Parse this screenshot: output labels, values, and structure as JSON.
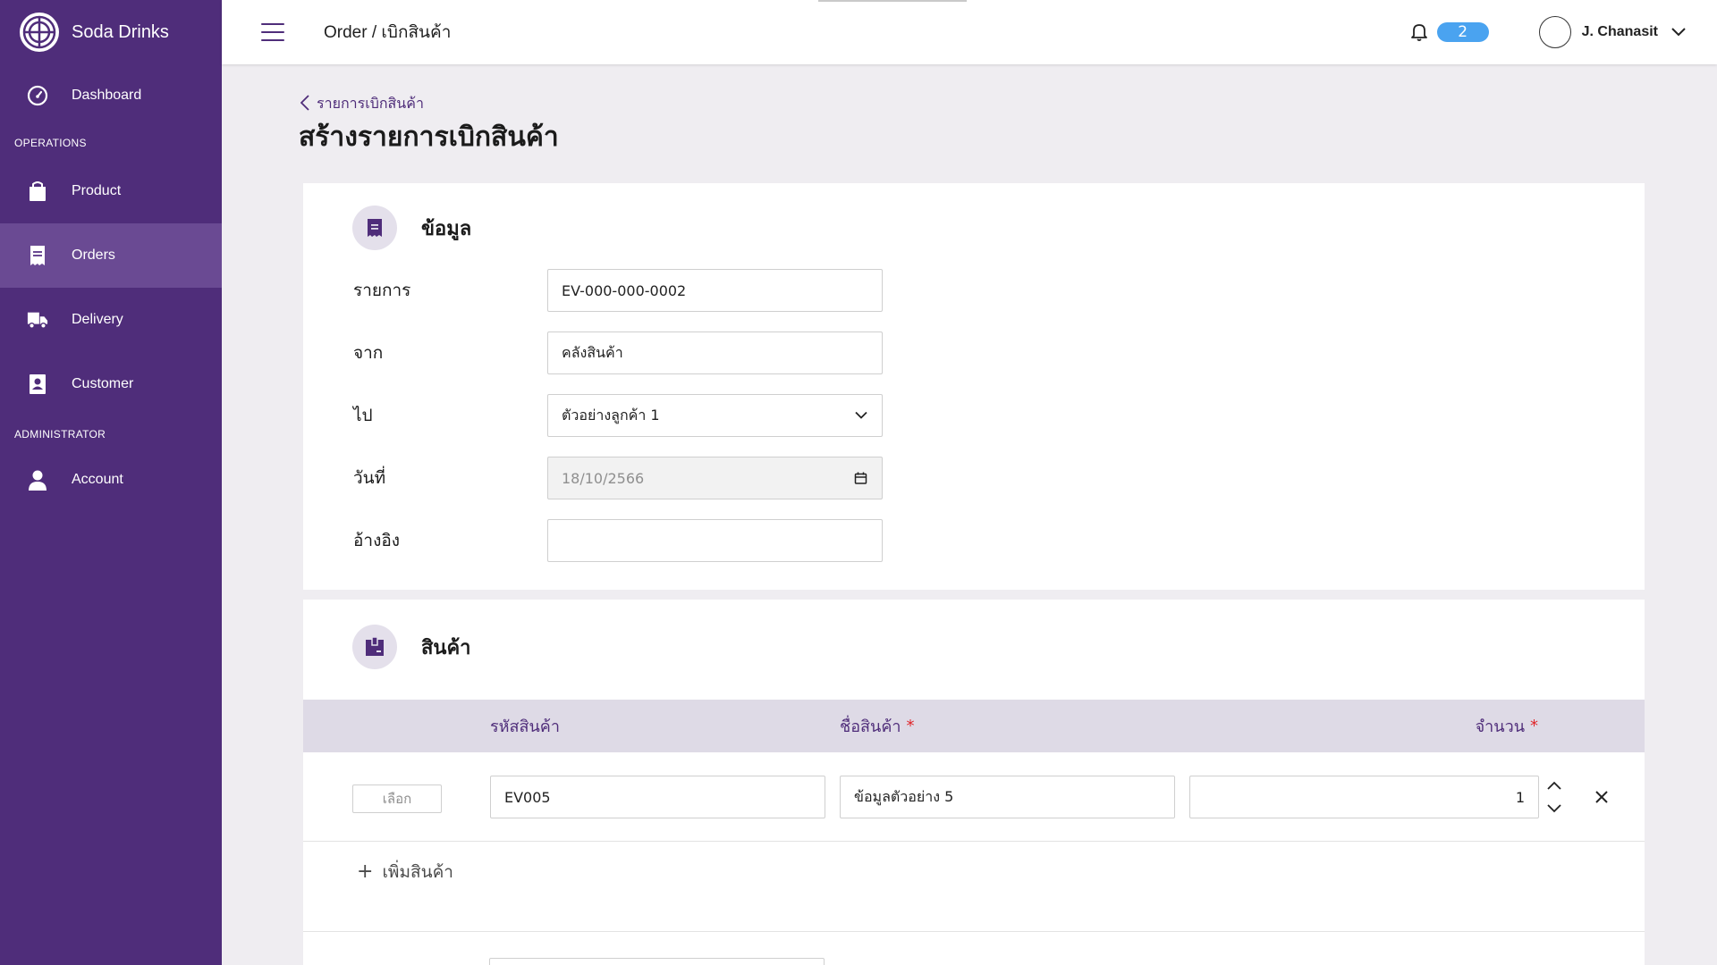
{
  "brand": {
    "name": "Soda Drinks"
  },
  "sidebar": {
    "dashboard": "Dashboard",
    "section_operations": "OPERATIONS",
    "product": "Product",
    "orders": "Orders",
    "delivery": "Delivery",
    "customer": "Customer",
    "section_admin": "ADMINISTRATOR",
    "account": "Account"
  },
  "topbar": {
    "breadcrumb": "Order / เบิกสินค้า",
    "notification_count": "2",
    "user_name": "J. Chanasit"
  },
  "page": {
    "back_link": "รายการเบิกสินค้า",
    "title": "สร้างรายการเบิกสินค้า"
  },
  "info_card": {
    "title": "ข้อมูล",
    "fields": {
      "doc_label": "รายการ",
      "doc_value": "EV-000-000-0002",
      "from_label": "จาก",
      "from_value": "คลังสินค้า",
      "to_label": "ไป",
      "to_value": "ตัวอย่างลูกค้า 1",
      "date_label": "วันที่",
      "date_value": "18/10/2566",
      "ref_label": "อ้างอิง",
      "ref_value": ""
    }
  },
  "product_card": {
    "title": "สินค้า",
    "columns": {
      "code": "รหัสสินค้า",
      "name": "ชื่อสินค้า",
      "qty": "จำนวน",
      "required_mark": "*"
    },
    "rows": [
      {
        "select_label": "เลือก",
        "code": "EV005",
        "name": "ข้อมูลตัวอย่าง 5",
        "qty": "1"
      }
    ],
    "add_label": "เพิ่มสินค้า",
    "add_symbol": "+"
  },
  "colors": {
    "brand_purple": "#4f2d7a",
    "active_nav": "#6a4a93",
    "badge_blue": "#4aa3f0",
    "required_red": "#e0262a",
    "table_header": "#dedae6"
  }
}
